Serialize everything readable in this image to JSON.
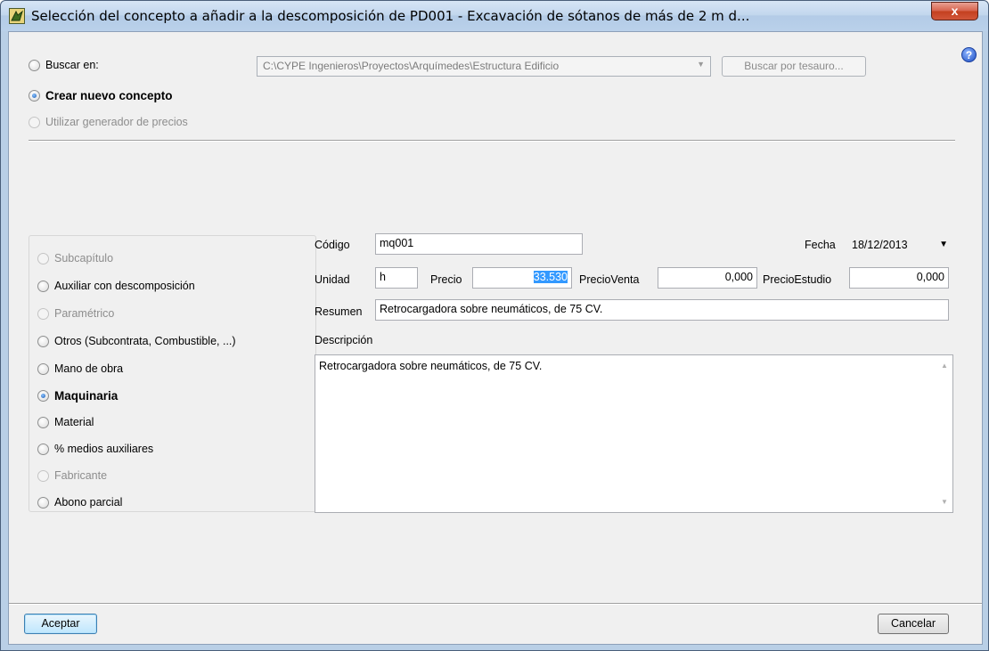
{
  "window": {
    "title": "Selección del concepto a añadir a la descomposición de PD001 - Excavación de sótanos de más de 2 m d...",
    "close_label": "x"
  },
  "source": {
    "search_label": "Buscar en:",
    "search_path": "C:\\CYPE Ingenieros\\Proyectos\\Arquímedes\\Estructura Edificio",
    "tesauro_label": "Buscar por tesauro...",
    "create_label": "Crear nuevo concepto",
    "generator_label": "Utilizar generador de precios",
    "help_label": "?"
  },
  "types": [
    {
      "label": "Subcapítulo",
      "enabled": false,
      "checked": false
    },
    {
      "label": "Auxiliar con descomposición",
      "enabled": true,
      "checked": false
    },
    {
      "label": "Paramétrico",
      "enabled": false,
      "checked": false
    },
    {
      "label": "Otros (Subcontrata, Combustible, ...)",
      "enabled": true,
      "checked": false
    },
    {
      "label": "Mano de obra",
      "enabled": true,
      "checked": false
    },
    {
      "label": "Maquinaria",
      "enabled": true,
      "checked": true
    },
    {
      "label": "Material",
      "enabled": true,
      "checked": false
    },
    {
      "label": "% medios auxiliares",
      "enabled": true,
      "checked": false
    },
    {
      "label": "Fabricante",
      "enabled": false,
      "checked": false
    },
    {
      "label": "Abono parcial",
      "enabled": true,
      "checked": false
    }
  ],
  "form": {
    "codigo_label": "Código",
    "codigo_value": "mq001",
    "fecha_label": "Fecha",
    "fecha_value": "18/12/2013",
    "unidad_label": "Unidad",
    "unidad_value": "h",
    "precio_label": "Precio",
    "precio_value": "33.530",
    "precio_venta_label": "PrecioVenta",
    "precio_venta_value": "0,000",
    "precio_estudio_label": "PrecioEstudio",
    "precio_estudio_value": "0,000",
    "resumen_label": "Resumen",
    "resumen_value": "Retrocargadora sobre neumáticos, de 75 CV.",
    "descripcion_label": "Descripción",
    "descripcion_value": "Retrocargadora sobre neumáticos, de 75 CV."
  },
  "footer": {
    "accept_label": "Aceptar",
    "cancel_label": "Cancelar"
  }
}
